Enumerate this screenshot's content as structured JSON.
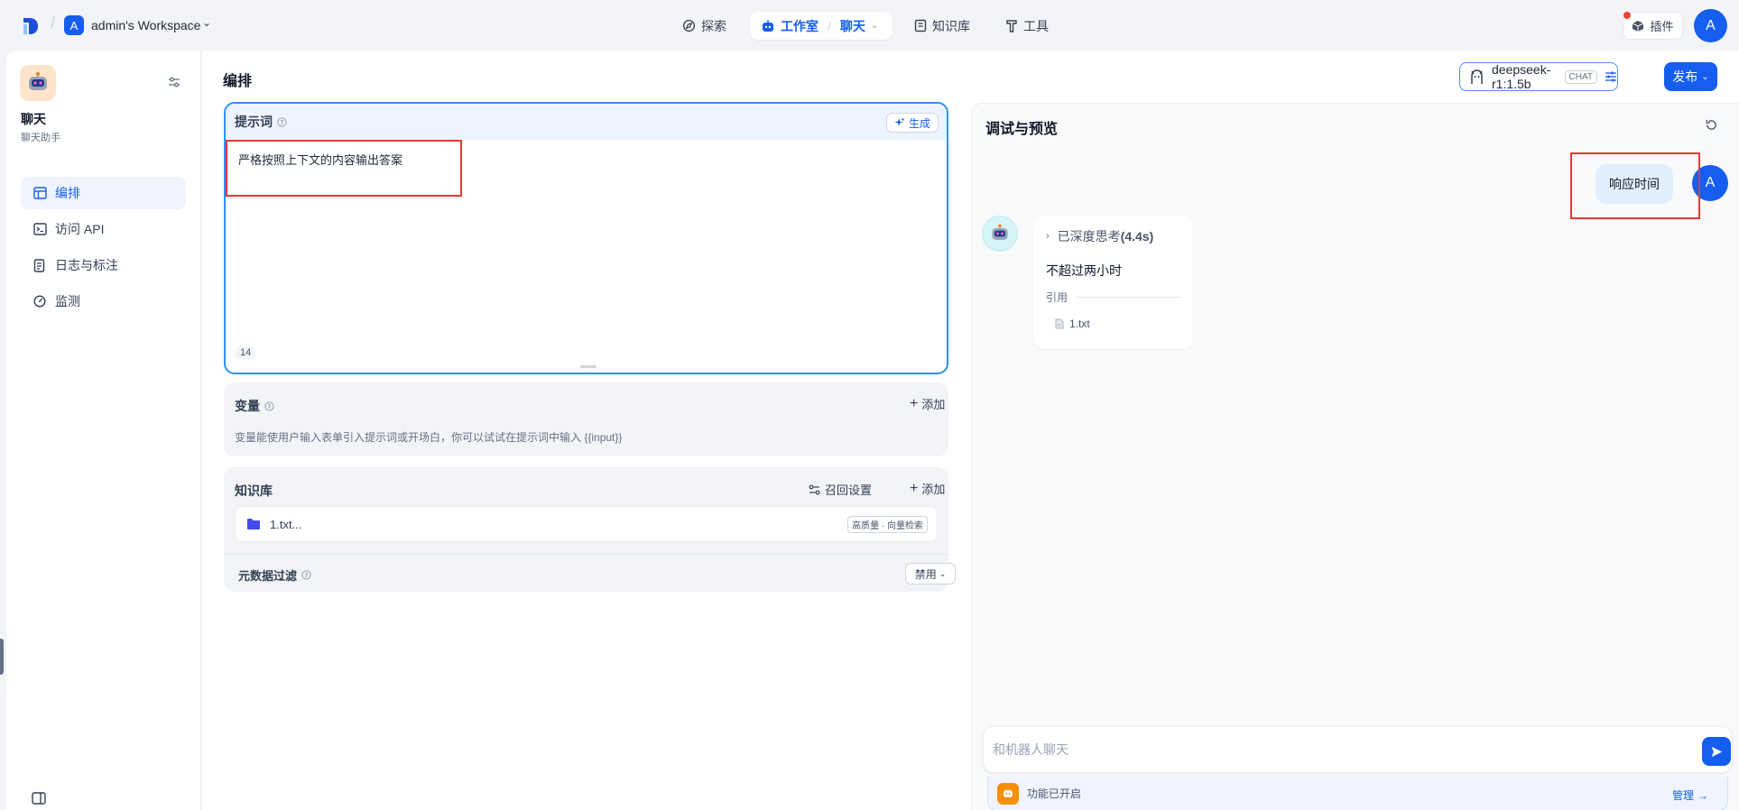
{
  "topbar": {
    "workspace_initial": "A",
    "workspace_name": "admin's Workspace",
    "nav": {
      "explore": "探索",
      "studio": "工作室",
      "app_switch": "聊天",
      "knowledge": "知识库",
      "tools": "工具"
    },
    "plugins": "插件",
    "user_initial": "A"
  },
  "sidebar": {
    "app_name": "聊天",
    "app_desc": "聊天助手",
    "items": [
      {
        "label": "编排",
        "icon": "layout-icon",
        "active": true
      },
      {
        "label": "访问 API",
        "icon": "terminal-icon",
        "active": false
      },
      {
        "label": "日志与标注",
        "icon": "file-list-icon",
        "active": false
      },
      {
        "label": "监测",
        "icon": "dashboard-icon",
        "active": false
      }
    ]
  },
  "main": {
    "title": "编排",
    "model": {
      "name": "deepseek-r1:1.5b",
      "mode": "CHAT"
    },
    "publish": "发布",
    "prompt": {
      "title": "提示词",
      "generate": "生成",
      "text": "严格按照上下文的内容输出答案",
      "count": "14"
    },
    "variables": {
      "title": "变量",
      "add": "添加",
      "desc": "变量能使用户输入表单引入提示词或开场白，你可以试试在提示词中输入 {{input}}"
    },
    "knowledge": {
      "title": "知识库",
      "recall": "召回设置",
      "add": "添加",
      "item_name": "1.txt...",
      "item_tag": "高质量 · 向量检索",
      "meta_filter": "元数据过滤",
      "meta_value": "禁用"
    }
  },
  "debug": {
    "title": "调试与预览",
    "user_message": "响应时间",
    "user_initial": "A",
    "thinking_label": "已深度思考",
    "thinking_time": "(4.4s)",
    "answer": "不超过两小时",
    "citation_label": "引用",
    "citation_file": "1.txt",
    "input_placeholder": "和机器人聊天",
    "feature_text": "功能已开启",
    "manage": "管理"
  },
  "colors": {
    "primary": "#155eef",
    "highlight_box": "#e53935",
    "prompt_border": "#2e90fa"
  }
}
